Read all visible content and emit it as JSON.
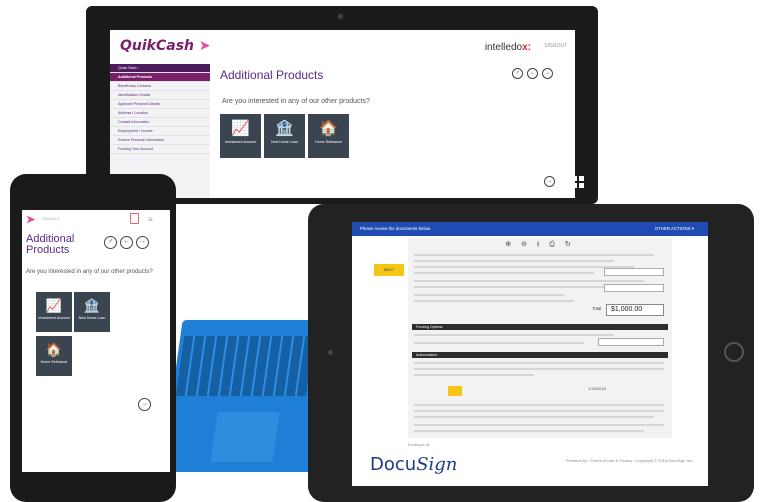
{
  "surface": {
    "brand": "QuikCash",
    "partner_brand": "intelledo",
    "partner_mark": "x:",
    "signout": "SIGNOUT",
    "sidebar_items": [
      "Quick Start •",
      "Additional Products",
      "Beneficiary Contacts",
      "Identification Details",
      "Applicant Personal Details",
      "Address / Location",
      "Contact Information",
      "Employment / Income",
      "Review Personal Information",
      "Funding Your Account"
    ],
    "title": "Additional Products",
    "question": "Are you interested in any of our other products?",
    "products": [
      {
        "icon": "investment-icon",
        "glyph": "📈",
        "label": "Investment Account"
      },
      {
        "icon": "home-loan-icon",
        "glyph": "🏦",
        "label": "New Home Loan"
      },
      {
        "icon": "home-refinance-icon",
        "glyph": "🏠",
        "label": "Home Refinance"
      }
    ],
    "nav_icons": [
      "♂",
      "←",
      "→"
    ],
    "next": "→"
  },
  "phone": {
    "logo": "➤",
    "signout": "SIGNOUT",
    "menu": "≡",
    "title": "Additional Products",
    "question": "Are you interested in any of our other products?",
    "products": [
      {
        "icon": "investment-icon",
        "glyph": "📈",
        "label": "Investment Account"
      },
      {
        "icon": "home-loan-icon",
        "glyph": "🏦",
        "label": "New Home Loan"
      },
      {
        "icon": "home-refinance-icon",
        "glyph": "🏠",
        "label": "Home Refinance"
      }
    ],
    "nav_icons": [
      "♂",
      "←",
      "→"
    ],
    "next": "→"
  },
  "tablet": {
    "bar_title": "Please review the documents below.",
    "other_actions": "OTHER ACTIONS ▾",
    "tools": "⊕ ⊖ ⭳ ⎙ ↻",
    "next_tag": "NEXT",
    "total_label": "Total",
    "total_value": "$1,000.00",
    "section_funding": "Funding Options",
    "section_auth": "Authorization",
    "date_value": "1/18/2018",
    "pager": "Envelope Id",
    "brand_prefix": "Docu",
    "brand_suffix": "Sign",
    "footer": "Powered by •  Terms of Use & Privacy •  Copyright © 2018 DocuSign Inc."
  },
  "colors": {
    "brand_purple": "#5b2a86",
    "brand_pink": "#e84c9a",
    "docusign_blue": "#1f4bb2",
    "keyboard_blue": "#1f7fd6",
    "tile_dark": "#3a4550"
  }
}
